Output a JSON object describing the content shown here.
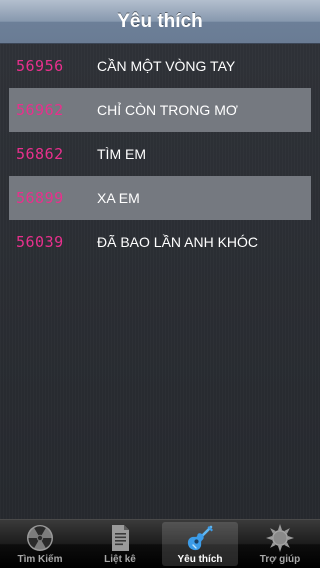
{
  "navbar": {
    "title": "Yêu thích"
  },
  "songs": [
    {
      "code": "56956",
      "title": "CẦN MỘT VÒNG TAY"
    },
    {
      "code": "56962",
      "title": "CHỈ CÒN TRONG MƠ"
    },
    {
      "code": "56862",
      "title": "TÌM EM"
    },
    {
      "code": "56899",
      "title": "XA EM"
    },
    {
      "code": "56039",
      "title": "ĐÃ BAO LẦN ANH KHÓC"
    }
  ],
  "tabbar": {
    "tabs": [
      {
        "label": "Tìm Kiếm",
        "icon": "radiation-icon"
      },
      {
        "label": "Liệt kê",
        "icon": "list-document-icon"
      },
      {
        "label": "Yêu thích",
        "icon": "guitar-icon"
      },
      {
        "label": "Trợ giúp",
        "icon": "sun-gear-icon"
      }
    ],
    "selected_index": 2
  },
  "colors": {
    "code": "#e8308d",
    "title": "#ffffff",
    "row_alt": "#757980",
    "selected_icon": "#3c9ce8"
  }
}
